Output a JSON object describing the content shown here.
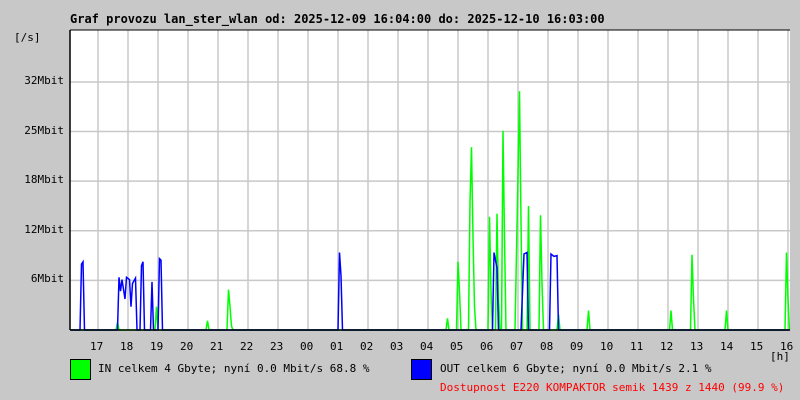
{
  "chart_data": {
    "type": "line",
    "title": "Graf provozu lan_ster_wlan od: 2025-12-09 16:04:00 do: 2025-12-10 16:03:00",
    "ylabel": "[/s]",
    "xlabel": "[h]",
    "ylim": [
      0,
      38.7
    ],
    "xlim_hours_since_16": [
      0.07,
      24.07
    ],
    "y_ticks": [
      {
        "label": "6Mbit",
        "value": 6.4
      },
      {
        "label": "12Mbit",
        "value": 12.8
      },
      {
        "label": "18Mbit",
        "value": 19.2
      },
      {
        "label": "25Mbit",
        "value": 25.6
      },
      {
        "label": "32Mbit",
        "value": 32
      }
    ],
    "x_ticks": [
      "17",
      "18",
      "19",
      "20",
      "21",
      "22",
      "23",
      "00",
      "01",
      "02",
      "03",
      "04",
      "05",
      "06",
      "07",
      "08",
      "09",
      "10",
      "11",
      "12",
      "13",
      "14",
      "15",
      "16"
    ],
    "grid": true,
    "series": [
      {
        "name": "IN",
        "color": "#00ff00",
        "points": [
          [
            0.1,
            0
          ],
          [
            1.6,
            0
          ],
          [
            1.65,
            1
          ],
          [
            1.7,
            0
          ],
          [
            2.9,
            0
          ],
          [
            2.95,
            3
          ],
          [
            3.0,
            0
          ],
          [
            4.6,
            0
          ],
          [
            4.65,
            1.2
          ],
          [
            4.7,
            0
          ],
          [
            5.3,
            0
          ],
          [
            5.35,
            5.2
          ],
          [
            5.4,
            3
          ],
          [
            5.45,
            0.5
          ],
          [
            5.5,
            0
          ],
          [
            12.6,
            0
          ],
          [
            12.65,
            1.5
          ],
          [
            12.7,
            0
          ],
          [
            12.95,
            0
          ],
          [
            13.0,
            8.8
          ],
          [
            13.05,
            5
          ],
          [
            13.1,
            0
          ],
          [
            13.35,
            0
          ],
          [
            13.4,
            16.5
          ],
          [
            13.45,
            23.6
          ],
          [
            13.5,
            12
          ],
          [
            13.55,
            3
          ],
          [
            13.6,
            0
          ],
          [
            14.0,
            0
          ],
          [
            14.05,
            14.6
          ],
          [
            14.1,
            5
          ],
          [
            14.15,
            0
          ],
          [
            14.25,
            0
          ],
          [
            14.3,
            15
          ],
          [
            14.35,
            4
          ],
          [
            14.4,
            0
          ],
          [
            14.45,
            0
          ],
          [
            14.5,
            25.7
          ],
          [
            14.55,
            12
          ],
          [
            14.6,
            0
          ],
          [
            14.9,
            0
          ],
          [
            15.0,
            20
          ],
          [
            15.05,
            30.8
          ],
          [
            15.1,
            14
          ],
          [
            15.15,
            0
          ],
          [
            15.3,
            0
          ],
          [
            15.35,
            16
          ],
          [
            15.4,
            0
          ],
          [
            15.7,
            0
          ],
          [
            15.75,
            14.8
          ],
          [
            15.8,
            6
          ],
          [
            15.85,
            0
          ],
          [
            16.3,
            0
          ],
          [
            16.35,
            2
          ],
          [
            16.4,
            0
          ],
          [
            17.3,
            0
          ],
          [
            17.35,
            2.5
          ],
          [
            17.4,
            0
          ],
          [
            20.05,
            0
          ],
          [
            20.1,
            2.5
          ],
          [
            20.15,
            0
          ],
          [
            20.75,
            0
          ],
          [
            20.8,
            9.7
          ],
          [
            20.85,
            4
          ],
          [
            20.9,
            0
          ],
          [
            21.9,
            0
          ],
          [
            21.95,
            2.5
          ],
          [
            22.0,
            0
          ],
          [
            23.9,
            0
          ],
          [
            23.95,
            10
          ],
          [
            24.0,
            4
          ],
          [
            24.05,
            0
          ]
        ]
      },
      {
        "name": "OUT",
        "color": "#0000ff",
        "points": [
          [
            0.1,
            0
          ],
          [
            0.4,
            0
          ],
          [
            0.45,
            8.5
          ],
          [
            0.5,
            8.8
          ],
          [
            0.55,
            0
          ],
          [
            1.65,
            0
          ],
          [
            1.7,
            6.8
          ],
          [
            1.75,
            5
          ],
          [
            1.8,
            6.5
          ],
          [
            1.9,
            4
          ],
          [
            1.95,
            6.8
          ],
          [
            2.05,
            6.5
          ],
          [
            2.1,
            3
          ],
          [
            2.15,
            6
          ],
          [
            2.25,
            6.7
          ],
          [
            2.3,
            0
          ],
          [
            2.4,
            0
          ],
          [
            2.45,
            8.3
          ],
          [
            2.5,
            8.8
          ],
          [
            2.55,
            0
          ],
          [
            2.75,
            0
          ],
          [
            2.8,
            6.2
          ],
          [
            2.85,
            0
          ],
          [
            3.0,
            0
          ],
          [
            3.05,
            9.2
          ],
          [
            3.1,
            9.0
          ],
          [
            3.15,
            0
          ],
          [
            9.0,
            0
          ],
          [
            9.05,
            10
          ],
          [
            9.1,
            7
          ],
          [
            9.15,
            0
          ],
          [
            14.15,
            0
          ],
          [
            14.2,
            10
          ],
          [
            14.3,
            8
          ],
          [
            14.35,
            0
          ],
          [
            15.1,
            0
          ],
          [
            15.2,
            9.8
          ],
          [
            15.3,
            10
          ],
          [
            15.35,
            0
          ],
          [
            16.05,
            0
          ],
          [
            16.1,
            9.8
          ],
          [
            16.2,
            9.5
          ],
          [
            16.3,
            9.6
          ],
          [
            16.35,
            0
          ],
          [
            24.05,
            0
          ]
        ]
      }
    ]
  },
  "legend": {
    "in_text": "IN celkem 4 Gbyte; nyní   0.0 Mbit/s 68.8 %",
    "out_text": "OUT celkem 6 Gbyte; nyní   0.0 Mbit/s 2.1 %",
    "availability": "Dostupnost E220 KOMPAKTOR semik 1439 z 1440 (99.9 %)"
  }
}
